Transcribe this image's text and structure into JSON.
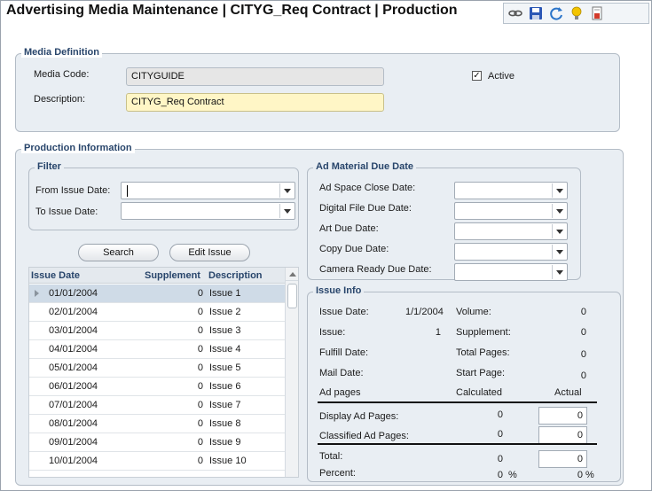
{
  "window": {
    "title": "Advertising Media Maintenance | CITYG_Req Contract | Production"
  },
  "toolbar": {
    "icons": [
      "link-icon",
      "save-icon",
      "refresh-icon",
      "lightbulb-icon",
      "report-icon"
    ]
  },
  "media_definition": {
    "title": "Media Definition",
    "media_code_label": "Media Code:",
    "media_code_value": "CITYGUIDE",
    "description_label": "Description:",
    "description_value": "CITYG_Req Contract",
    "active_label": "Active",
    "active_checked": true,
    "active_mark": "✓"
  },
  "production": {
    "title": "Production Information"
  },
  "filter": {
    "title": "Filter",
    "from_label": "From Issue Date:",
    "from_value": "",
    "to_label": "To Issue Date:",
    "to_value": ""
  },
  "buttons": {
    "search": "Search",
    "edit_issue": "Edit Issue"
  },
  "issues_grid": {
    "columns": [
      "Issue Date",
      "Supplement",
      "Description"
    ],
    "rows": [
      {
        "date": "01/01/2004",
        "supplement": "0",
        "description": "Issue 1",
        "selected": true
      },
      {
        "date": "02/01/2004",
        "supplement": "0",
        "description": "Issue 2"
      },
      {
        "date": "03/01/2004",
        "supplement": "0",
        "description": "Issue 3"
      },
      {
        "date": "04/01/2004",
        "supplement": "0",
        "description": "Issue 4"
      },
      {
        "date": "05/01/2004",
        "supplement": "0",
        "description": "Issue 5"
      },
      {
        "date": "06/01/2004",
        "supplement": "0",
        "description": "Issue 6"
      },
      {
        "date": "07/01/2004",
        "supplement": "0",
        "description": "Issue 7"
      },
      {
        "date": "08/01/2004",
        "supplement": "0",
        "description": "Issue 8"
      },
      {
        "date": "09/01/2004",
        "supplement": "0",
        "description": "Issue 9"
      },
      {
        "date": "10/01/2004",
        "supplement": "0",
        "description": "Issue 10"
      }
    ]
  },
  "ad_material": {
    "title": "Ad Material Due Date",
    "fields": [
      {
        "label": "Ad Space Close Date:",
        "value": ""
      },
      {
        "label": "Digital File Due Date:",
        "value": ""
      },
      {
        "label": "Art Due Date:",
        "value": ""
      },
      {
        "label": "Copy Due Date:",
        "value": ""
      },
      {
        "label": "Camera Ready Due Date:",
        "value": ""
      }
    ]
  },
  "issue_info": {
    "title": "Issue Info",
    "issue_date_label": "Issue Date:",
    "issue_date_value": "1/1/2004",
    "volume_label": "Volume:",
    "volume_value": "0",
    "issue_label": "Issue:",
    "issue_value": "1",
    "supplement_label": "Supplement:",
    "supplement_value": "0",
    "fulfill_label": "Fulfill Date:",
    "total_pages_label": "Total Pages:",
    "total_pages_value": "0",
    "mail_label": "Mail Date:",
    "start_page_label": "Start Page:",
    "start_page_value": "0",
    "ad_pages_label": "Ad pages",
    "calculated_label": "Calculated",
    "actual_label": "Actual",
    "display_label": "Display Ad Pages:",
    "display_calc": "0",
    "display_actual": "0",
    "classified_label": "Classified Ad Pages:",
    "classified_calc": "0",
    "classified_actual": "0",
    "total_label": "Total:",
    "total_calc": "0",
    "total_actual": "0",
    "percent_label": "Percent:",
    "percent_calc": "0",
    "percent_actual": "0",
    "percent_sign": "%"
  }
}
